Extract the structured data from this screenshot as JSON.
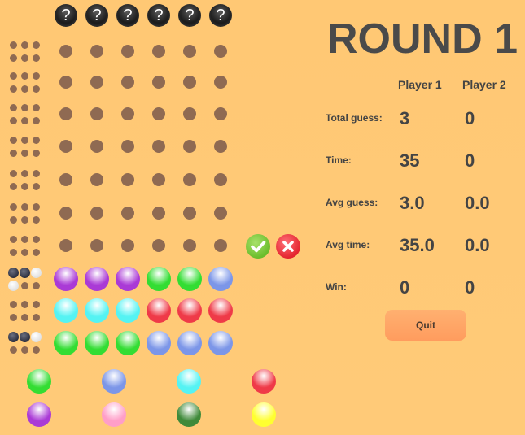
{
  "round": {
    "title": "ROUND 1"
  },
  "secret_code": {
    "symbols": [
      "?",
      "?",
      "?",
      "?",
      "?",
      "?"
    ]
  },
  "players": {
    "p1": "Player 1",
    "p2": "Player 2"
  },
  "stats": [
    {
      "label": "Total guess:",
      "p1": "3",
      "p2": "0"
    },
    {
      "label": "Time:",
      "p1": "35",
      "p2": "0"
    },
    {
      "label": "Avg guess:",
      "p1": "3.0",
      "p2": "0.0"
    },
    {
      "label": "Avg time:",
      "p1": "35.0",
      "p2": "0.0"
    },
    {
      "label": "Win:",
      "p1": "0",
      "p2": "0"
    }
  ],
  "quit_label": "Quit",
  "guess_rows": [
    {
      "colors": [
        "purple",
        "purple",
        "purple",
        "green",
        "green",
        "blue"
      ],
      "feedback": [
        "black",
        "black",
        "white",
        "white",
        "empty",
        "empty"
      ]
    },
    {
      "colors": [
        "cyan",
        "cyan",
        "cyan",
        "red",
        "red",
        "red"
      ],
      "feedback": [
        "empty",
        "empty",
        "empty",
        "empty",
        "empty",
        "empty"
      ]
    },
    {
      "colors": [
        "green",
        "green",
        "green",
        "blue",
        "blue",
        "blue"
      ],
      "feedback": [
        "black",
        "black",
        "white",
        "empty",
        "empty",
        "empty"
      ]
    }
  ],
  "palette": [
    {
      "name": "green",
      "hex": "#33dd33"
    },
    {
      "name": "blue",
      "hex": "#7c96e8"
    },
    {
      "name": "cyan",
      "hex": "#55f3f3"
    },
    {
      "name": "red",
      "hex": "#ef3a48"
    },
    {
      "name": "purple",
      "hex": "#aa3ad6"
    },
    {
      "name": "pink",
      "hex": "#ff9ec8"
    },
    {
      "name": "darkgreen",
      "hex": "#3f8a3a"
    },
    {
      "name": "yellow",
      "hex": "#ffff30"
    }
  ]
}
